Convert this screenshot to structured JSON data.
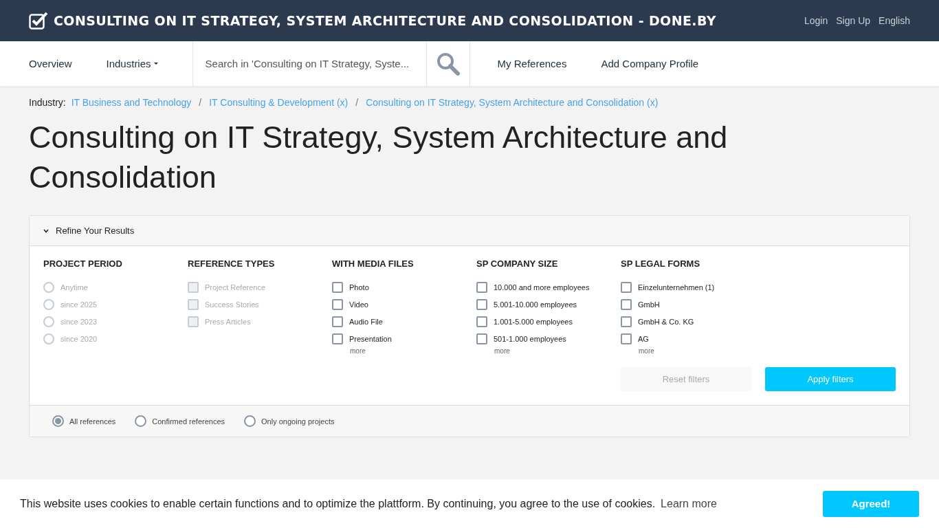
{
  "header": {
    "title": "CONSULTING ON IT STRATEGY, SYSTEM ARCHITECTURE AND CONSOLIDATION - DONE.BY",
    "links": [
      "Login",
      "Sign Up",
      "English"
    ]
  },
  "nav": {
    "items": [
      {
        "label": "Overview",
        "kind": "link"
      },
      {
        "label": "Industries",
        "kind": "dropdown"
      }
    ],
    "search": {
      "placeholder": "Search in 'Consulting on IT Strategy, Syste..."
    },
    "extra": [
      "My References",
      "Add Company Profile"
    ]
  },
  "breadcrumb": {
    "label": "Industry:",
    "separator": "/",
    "items": [
      "IT Business and Technology",
      "IT Consulting & Development (x)",
      "Consulting on IT Strategy, System Architecture and Consolidation (x)"
    ]
  },
  "page_title": "Consulting on IT Strategy, System Architecture and Consolidation",
  "filters": {
    "title": "Refine Your Results",
    "expanded": true,
    "groups": [
      {
        "heading": "PROJECT PERIOD",
        "kind": "radio",
        "items": [
          {
            "label": "Anytime",
            "checked": false,
            "disabled": true
          },
          {
            "label": "since 2025",
            "checked": false,
            "disabled": true
          },
          {
            "label": "since 2023",
            "checked": false,
            "disabled": true
          },
          {
            "label": "since 2020",
            "checked": false,
            "disabled": true
          }
        ]
      },
      {
        "heading": "REFERENCE TYPES",
        "kind": "checkbox",
        "items": [
          {
            "label": "Project Reference",
            "checked": false,
            "disabled": true
          },
          {
            "label": "Success Stories",
            "checked": false,
            "disabled": true
          },
          {
            "label": "Press Articles",
            "checked": false,
            "disabled": true
          }
        ]
      },
      {
        "heading": "WITH MEDIA FILES",
        "kind": "checkbox",
        "more": "more",
        "items": [
          {
            "label": "Photo",
            "checked": false,
            "disabled": false
          },
          {
            "label": "Video",
            "checked": false,
            "disabled": false
          },
          {
            "label": "Audio File",
            "checked": false,
            "disabled": false
          },
          {
            "label": "Presentation",
            "checked": false,
            "disabled": false
          }
        ]
      },
      {
        "heading": "SP COMPANY SIZE",
        "kind": "checkbox",
        "more": "more",
        "items": [
          {
            "label": "10.000 and more employees",
            "checked": false,
            "disabled": false
          },
          {
            "label": "5.001-10.000 employees",
            "checked": false,
            "disabled": false
          },
          {
            "label": "1.001-5.000 employees",
            "checked": false,
            "disabled": false
          },
          {
            "label": "501-1.000 employees",
            "checked": false,
            "disabled": false
          }
        ]
      },
      {
        "heading": "SP LEGAL FORMS",
        "kind": "checkbox",
        "more": "more",
        "items": [
          {
            "label": "Einzelunternehmen (1)",
            "checked": false,
            "disabled": false
          },
          {
            "label": "GmbH",
            "checked": false,
            "disabled": false
          },
          {
            "label": "GmbH & Co. KG",
            "checked": false,
            "disabled": false
          },
          {
            "label": "AG",
            "checked": false,
            "disabled": false
          }
        ]
      }
    ],
    "reset": {
      "label": "Reset filters",
      "disabled": true
    },
    "apply": {
      "label": "Apply filters"
    },
    "scope": [
      {
        "label": "All references",
        "selected": true
      },
      {
        "label": "Confirmed references",
        "selected": false
      },
      {
        "label": "Only ongoing projects",
        "selected": false
      }
    ]
  },
  "cookie": {
    "text": "This website uses cookies to enable certain functions and to optimize the plattform. By continuing, you agree to the use of cookies.",
    "link": "Learn more",
    "button": "Agreed!"
  }
}
